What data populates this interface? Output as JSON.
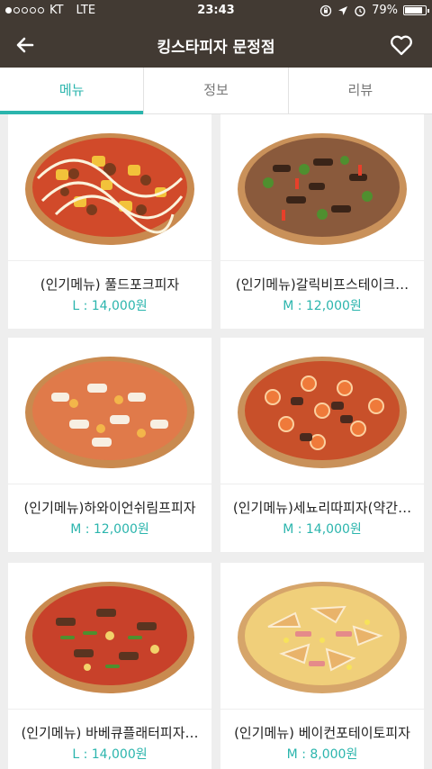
{
  "status": {
    "carrier": "KT",
    "network": "LTE",
    "time": "23:43",
    "battery": "79%"
  },
  "header": {
    "title": "킹스타피자 문정점"
  },
  "tabs": [
    {
      "label": "메뉴"
    },
    {
      "label": "정보"
    },
    {
      "label": "리뷰"
    }
  ],
  "menu": [
    {
      "name": "(인기메뉴) 풀드포크피자",
      "price": "L : 14,000원"
    },
    {
      "name": "(인기메뉴)갈릭비프스테이크…",
      "price": "M : 12,000원"
    },
    {
      "name": "(인기메뉴)하와이언쉬림프피자",
      "price": "M : 12,000원"
    },
    {
      "name": "(인기메뉴)세뇨리따피자(약간…",
      "price": "M : 14,000원"
    },
    {
      "name": "(인기메뉴) 바베큐플래터피자…",
      "price": "L : 14,000원"
    },
    {
      "name": "(인기메뉴) 베이컨포테이토피자",
      "price": "M : 8,000원"
    }
  ],
  "colors": {
    "header_bg": "#423a33",
    "accent": "#2bb5ad"
  }
}
